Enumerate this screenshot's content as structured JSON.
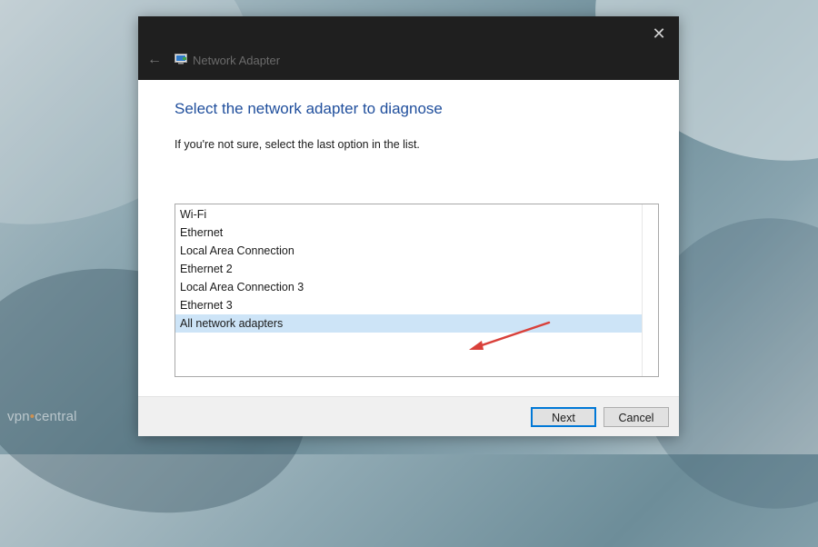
{
  "window": {
    "title": "Network Adapter",
    "close_glyph": "✕",
    "back_glyph": "←"
  },
  "main": {
    "heading": "Select the network adapter to diagnose",
    "subtext": "If you're not sure, select the last option in the list."
  },
  "adapters": {
    "items": [
      {
        "label": "Wi-Fi",
        "selected": false
      },
      {
        "label": "Ethernet",
        "selected": false
      },
      {
        "label": "Local Area Connection",
        "selected": false
      },
      {
        "label": "Ethernet 2",
        "selected": false
      },
      {
        "label": "Local Area Connection 3",
        "selected": false
      },
      {
        "label": "Ethernet 3",
        "selected": false
      },
      {
        "label": "All network adapters",
        "selected": true
      }
    ]
  },
  "buttons": {
    "next_label": "Next",
    "cancel_label": "Cancel"
  },
  "watermark": {
    "part1": "vpn",
    "part2": "central"
  },
  "colors": {
    "heading": "#1f4e9c",
    "titlebar": "#1f1f1f",
    "selected_row": "#cde4f7",
    "annotation_arrow": "#d9403a"
  },
  "icons": {
    "app": "network-adapter-icon",
    "back": "back-arrow-icon",
    "close": "close-icon"
  }
}
